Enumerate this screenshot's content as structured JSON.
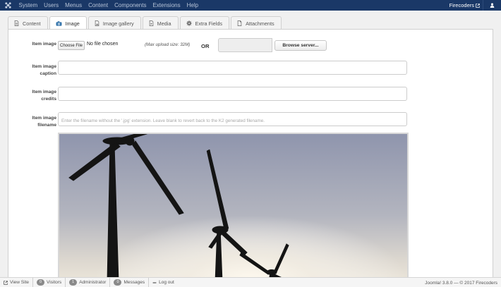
{
  "topnav": {
    "menu": [
      "System",
      "Users",
      "Menus",
      "Content",
      "Components",
      "Extensions",
      "Help"
    ],
    "site_name": "Firecoders"
  },
  "tabs": [
    {
      "label": "Content",
      "icon": "document-icon"
    },
    {
      "label": "Image",
      "icon": "camera-icon",
      "active": true
    },
    {
      "label": "Image gallery",
      "icon": "image-file-icon"
    },
    {
      "label": "Media",
      "icon": "media-file-icon"
    },
    {
      "label": "Extra Fields",
      "icon": "gear-icon"
    },
    {
      "label": "Attachments",
      "icon": "file-icon"
    }
  ],
  "form": {
    "item_image": {
      "label_line1": "Item image",
      "choose_file": "Choose File",
      "no_file": "No file chosen",
      "max_size": "(Max upload size: 32M)",
      "or": "OR",
      "browse_server": "Browse server..."
    },
    "caption": {
      "label_line1": "Item image",
      "label_line2": "caption",
      "value": ""
    },
    "credits": {
      "label_line1": "Item image",
      "label_line2": "credits",
      "value": ""
    },
    "filename": {
      "label_line1": "Item image",
      "label_line2": "filename",
      "placeholder": "Enter the filename without the '.jpg' extension. Leave blank to revert back to the K2 generated filename."
    }
  },
  "statusbar": {
    "view_site": "View Site",
    "visitors_count": "0",
    "visitors": "Visitors",
    "admin_count": "1",
    "administrator": "Administrator",
    "messages_count": "0",
    "messages": "Messages",
    "logout": "Log out",
    "footer": "Joomla! 3.8.0  —  © 2017 Firecoders"
  },
  "colors": {
    "topbar": "#1a3867",
    "topbar_text": "#b7c4d8",
    "panel_bg": "#ffffff",
    "page_bg": "#f0f0f0"
  }
}
